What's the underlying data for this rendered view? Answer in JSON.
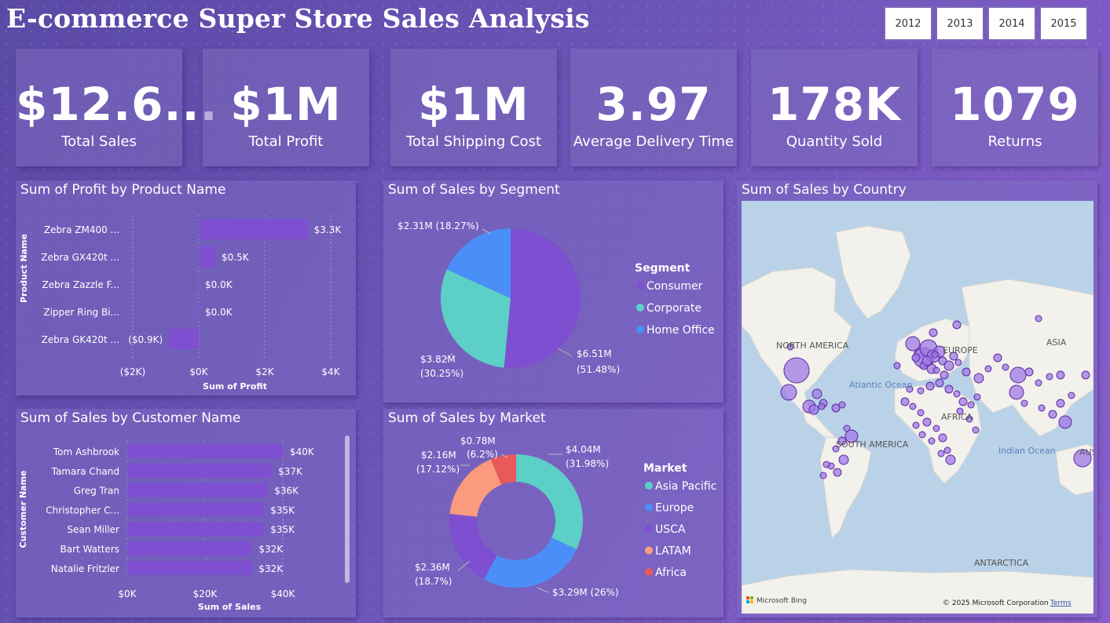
{
  "header": {
    "title": "E-commerce Super Store Sales Analysis"
  },
  "year_filter": [
    "2012",
    "2013",
    "2014",
    "2015"
  ],
  "kpis": [
    {
      "value": "$12.6...",
      "label": "Total Sales"
    },
    {
      "value": "$1M",
      "label": "Total Profit"
    },
    {
      "value": "$1M",
      "label": "Total Shipping Cost"
    },
    {
      "value": "3.97",
      "label": "Average Delivery Time"
    },
    {
      "value": "178K",
      "label": "Quantity Sold"
    },
    {
      "value": "1079",
      "label": "Returns"
    }
  ],
  "profit_by_product": {
    "title": "Sum of Profit by Product Name",
    "ylabel": "Product Name",
    "xlabel": "Sum of Profit",
    "ticks": [
      "($2K)",
      "$0K",
      "$2K",
      "$4K"
    ],
    "bar_color": "#7e4fd0"
  },
  "sales_by_customer": {
    "title": "Sum of Sales by Customer Name",
    "ylabel": "Customer Name",
    "xlabel": "Sum of Sales",
    "ticks": [
      "$0K",
      "$20K",
      "$40K"
    ],
    "bar_color": "#7e4fd0"
  },
  "sales_by_segment": {
    "title": "Sum of Sales by Segment",
    "legend_title": "Segment"
  },
  "sales_by_market": {
    "title": "Sum of Sales by Market",
    "legend_title": "Market"
  },
  "sales_by_country": {
    "title": "Sum of Sales by Country",
    "labels": {
      "north_america": "NORTH AMERICA",
      "europe": "EUROPE",
      "asia": "ASIA",
      "atlantic": "Atlantic Ocean",
      "africa": "AFRICA",
      "south_america": "SOUTH AMERICA",
      "indian": "Indian Ocean",
      "antarctica": "ANTARCTICA",
      "aus_cut": "AUS"
    },
    "attribution": "Microsoft Bing",
    "copyright": "© 2025 Microsoft Corporation",
    "terms": "Terms"
  },
  "chart_data": [
    {
      "type": "bar",
      "title": "Sum of Profit by Product Name",
      "categories": [
        "Zebra ZM400 ...",
        "Zebra GX420t ...",
        "Zebra Zazzle F...",
        "Zipper Ring Bi...",
        "Zebra GK420t ..."
      ],
      "values": [
        3300,
        500,
        0,
        0,
        -900
      ],
      "data_labels": [
        "$3.3K",
        "$0.5K",
        "$0.0K",
        "$0.0K",
        "($0.9K)"
      ],
      "xlim": [
        -2500,
        4500
      ],
      "xlabel": "Sum of Profit",
      "ylabel": "Product Name"
    },
    {
      "type": "bar",
      "title": "Sum of Sales by Customer Name",
      "categories": [
        "Tom Ashbrook",
        "Tamara Chand",
        "Greg Tran",
        "Christopher C...",
        "Sean Miller",
        "Bart Watters",
        "Natalie Fritzler"
      ],
      "values": [
        40000,
        37000,
        36000,
        35000,
        35000,
        32000,
        32000
      ],
      "data_labels": [
        "$40K",
        "$37K",
        "$36K",
        "$35K",
        "$35K",
        "$32K",
        "$32K"
      ],
      "xlim": [
        0,
        44000
      ],
      "xlabel": "Sum of Sales",
      "ylabel": "Customer Name"
    },
    {
      "type": "pie",
      "title": "Sum of Sales by Segment",
      "legend": "right",
      "slices": [
        {
          "name": "Consumer",
          "value": 6.51,
          "label1": "$6.51M",
          "label2": "(51.48%)",
          "color": "#7e4fd0"
        },
        {
          "name": "Corporate",
          "value": 3.82,
          "label1": "$3.82M",
          "label2": "(30.25%)",
          "color": "#5ccfc6"
        },
        {
          "name": "Home Office",
          "value": 2.31,
          "label1": "$2.31M (18.27%)",
          "label2": "",
          "color": "#4a8ff7"
        }
      ]
    },
    {
      "type": "pie",
      "title": "Sum of Sales by Market",
      "donut": true,
      "legend": "right",
      "slices": [
        {
          "name": "Asia Pacific",
          "value": 4.04,
          "label1": "$4.04M",
          "label2": "(31.98%)",
          "color": "#5ccfc6"
        },
        {
          "name": "Europe",
          "value": 3.29,
          "label1": "$3.29M (26%)",
          "label2": "",
          "color": "#4a8ff7"
        },
        {
          "name": "USCA",
          "value": 2.36,
          "label1": "$2.36M",
          "label2": "(18.7%)",
          "color": "#7e4fd0"
        },
        {
          "name": "LATAM",
          "value": 2.16,
          "label1": "$2.16M",
          "label2": "(17.12%)",
          "color": "#fb9a7c"
        },
        {
          "name": "Africa",
          "value": 0.78,
          "label1": "$0.78M",
          "label2": "(6.2%)",
          "color": "#e85a5a"
        }
      ]
    }
  ]
}
